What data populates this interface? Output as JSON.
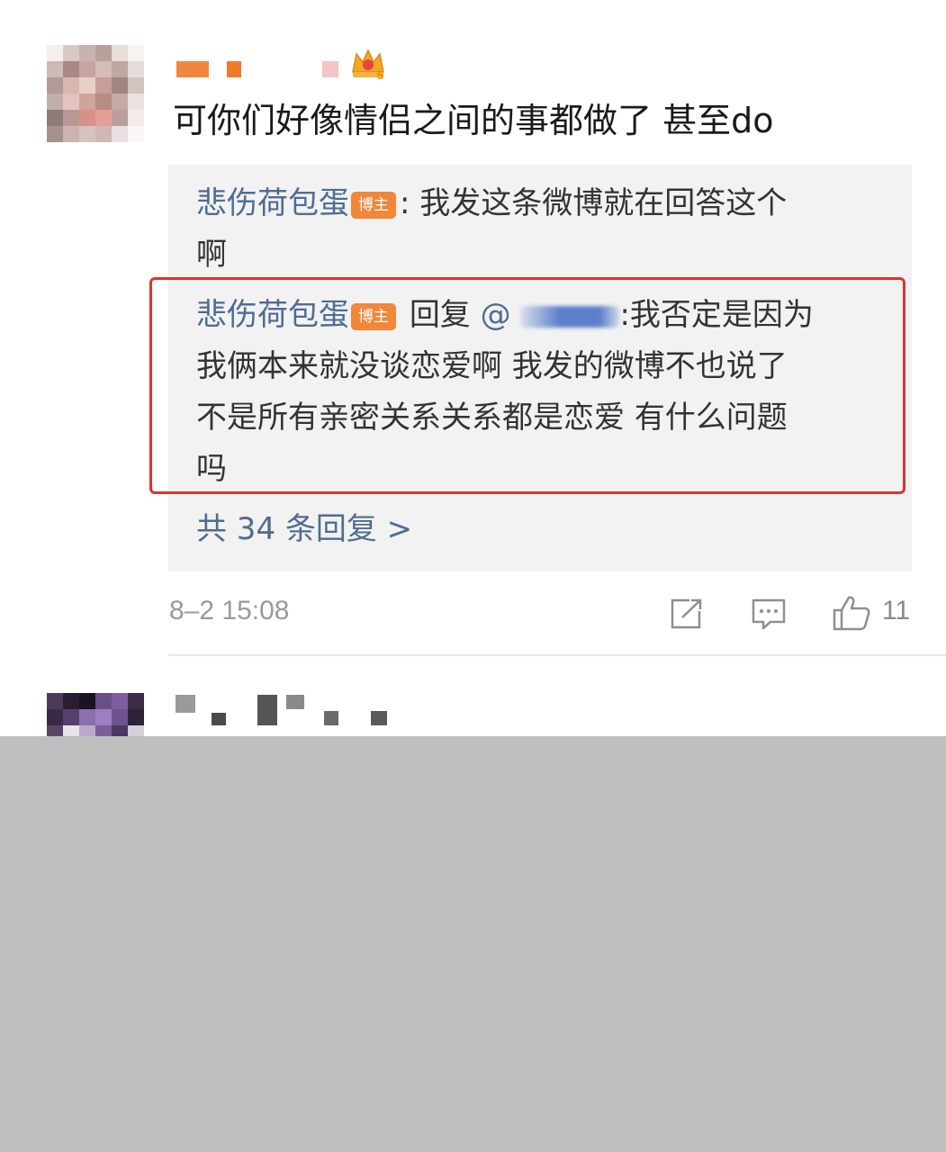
{
  "comment": {
    "text": "可你们好像情侣之间的事都做了 甚至do"
  },
  "replies": [
    {
      "username": "悲伤荷包蛋",
      "badge": "博主",
      "text_line1": ": 我发这条微博就在回答这个",
      "text_line2": "啊"
    },
    {
      "username": "悲伤荷包蛋",
      "badge": "博主",
      "reply_word": "回复",
      "at": "@",
      "text_line1": ":我否定是因为",
      "text_line2": "我俩本来就没谈恋爱啊 我发的微博不也说了",
      "text_line3": "不是所有亲密关系关系都是恋爱 有什么问题",
      "text_line4": "吗"
    }
  ],
  "more_replies": "共 34 条回复 >",
  "timestamp": "8–2 15:08",
  "like_count": "11",
  "icons": [
    "share-icon",
    "comment-icon",
    "like-icon",
    "crown-level-icon"
  ],
  "colors": {
    "username": "#4f6c92",
    "badge": "#f0873a",
    "highlight": "#e0312e",
    "reply_bg": "#f2f2f2"
  }
}
